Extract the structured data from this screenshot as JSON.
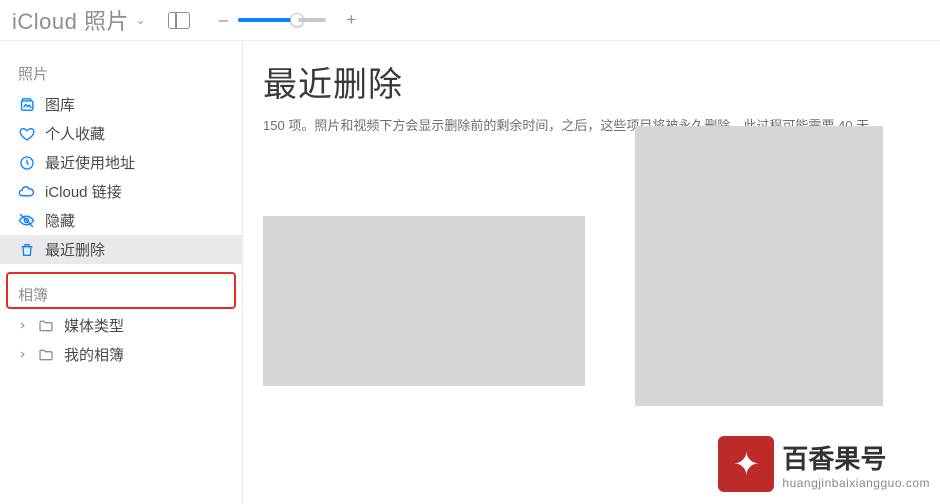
{
  "topbar": {
    "title": "iCloud 照片",
    "zoom_minus": "–",
    "zoom_plus": "+"
  },
  "sidebar": {
    "section_photos": "照片",
    "items": [
      {
        "label": "图库"
      },
      {
        "label": "个人收藏"
      },
      {
        "label": "最近使用地址"
      },
      {
        "label": "iCloud 链接"
      },
      {
        "label": "隐藏"
      },
      {
        "label": "最近删除"
      }
    ],
    "section_albums": "相簿",
    "album_items": [
      {
        "label": "媒体类型"
      },
      {
        "label": "我的相簿"
      }
    ]
  },
  "main": {
    "heading": "最近删除",
    "count": "150",
    "count_unit": "项",
    "desc_sep": "。",
    "desc_part1": "照片和视频下方会显示删除前的剩余时间，之后，这些项目将被永久删除。此过程可能需要",
    "days": "40",
    "days_unit": "天。"
  },
  "watermark": {
    "title": "百香果号",
    "url": "huangjinbaixiangguo.com"
  }
}
